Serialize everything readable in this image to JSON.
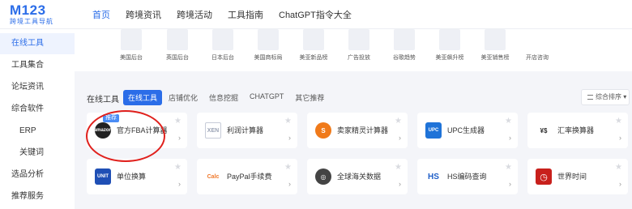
{
  "logo": {
    "main": "M123",
    "sub": "跨境工具导航"
  },
  "nav": {
    "items": [
      {
        "label": "首页",
        "active": true
      },
      {
        "label": "跨境资讯",
        "active": false
      },
      {
        "label": "跨境活动",
        "active": false
      },
      {
        "label": "工具指南",
        "active": false
      },
      {
        "label": "ChatGPT指令大全",
        "active": false
      }
    ]
  },
  "sidebar": {
    "items": [
      {
        "label": "在线工具",
        "active": true
      },
      {
        "label": "工具集合"
      },
      {
        "label": "论坛资讯"
      },
      {
        "label": "综合软件"
      },
      {
        "label": "ERP"
      },
      {
        "label": "关键词"
      },
      {
        "label": "选品分析"
      },
      {
        "label": "推荐服务"
      }
    ]
  },
  "upper": {
    "items": [
      {
        "label": "美国后台"
      },
      {
        "label": "英国后台"
      },
      {
        "label": "日本后台"
      },
      {
        "label": "美国商标局"
      },
      {
        "label": "美亚新品榜"
      },
      {
        "label": "广告投放"
      },
      {
        "label": "谷歌趋势"
      },
      {
        "label": "美亚飙升榜"
      },
      {
        "label": "美亚销售榜"
      },
      {
        "label": "开店咨询"
      }
    ]
  },
  "section": {
    "title": "在线工具",
    "tabs": [
      {
        "label": "在线工具",
        "active": true
      },
      {
        "label": "店铺优化"
      },
      {
        "label": "信息挖掘"
      },
      {
        "label": "CHATGPT"
      },
      {
        "label": "其它推荐"
      }
    ],
    "sort_label": "综合排序"
  },
  "tools": [
    {
      "name": "官方FBA计算器",
      "icon_text": "amazon",
      "icon_name": "amazon-icon",
      "color": "#222222",
      "badge": "推荐"
    },
    {
      "name": "利润计算器",
      "icon_text": "XEN",
      "icon_name": "profit-icon",
      "color": "#9aa3b5"
    },
    {
      "name": "卖家精灵计算器",
      "icon_text": "S",
      "icon_name": "sellersprite-icon",
      "color": "#f07a1a"
    },
    {
      "name": "UPC生成器",
      "icon_text": "UPC",
      "icon_name": "upc-icon",
      "color": "#1f73d8"
    },
    {
      "name": "汇率换算器",
      "icon_text": "¥$",
      "icon_name": "exchange-icon",
      "color": "#333333"
    },
    {
      "name": "单位换算",
      "icon_text": "UNIT",
      "icon_name": "unit-icon",
      "color": "#1f4fb5"
    },
    {
      "name": "PayPal手续费",
      "icon_text": "Calc",
      "icon_name": "paypal-calc-icon",
      "color": "#f0782a"
    },
    {
      "name": "全球海关数据",
      "icon_text": "◎",
      "icon_name": "customs-icon",
      "color": "#444444"
    },
    {
      "name": "HS编码查询",
      "icon_text": "HS",
      "icon_name": "hs-code-icon",
      "color": "#1f5fc8"
    },
    {
      "name": "世界时间",
      "icon_text": "◷",
      "icon_name": "world-time-icon",
      "color": "#c8201c"
    }
  ],
  "colors": {
    "accent": "#2b6de8",
    "highlight_circle": "#e0201c"
  }
}
